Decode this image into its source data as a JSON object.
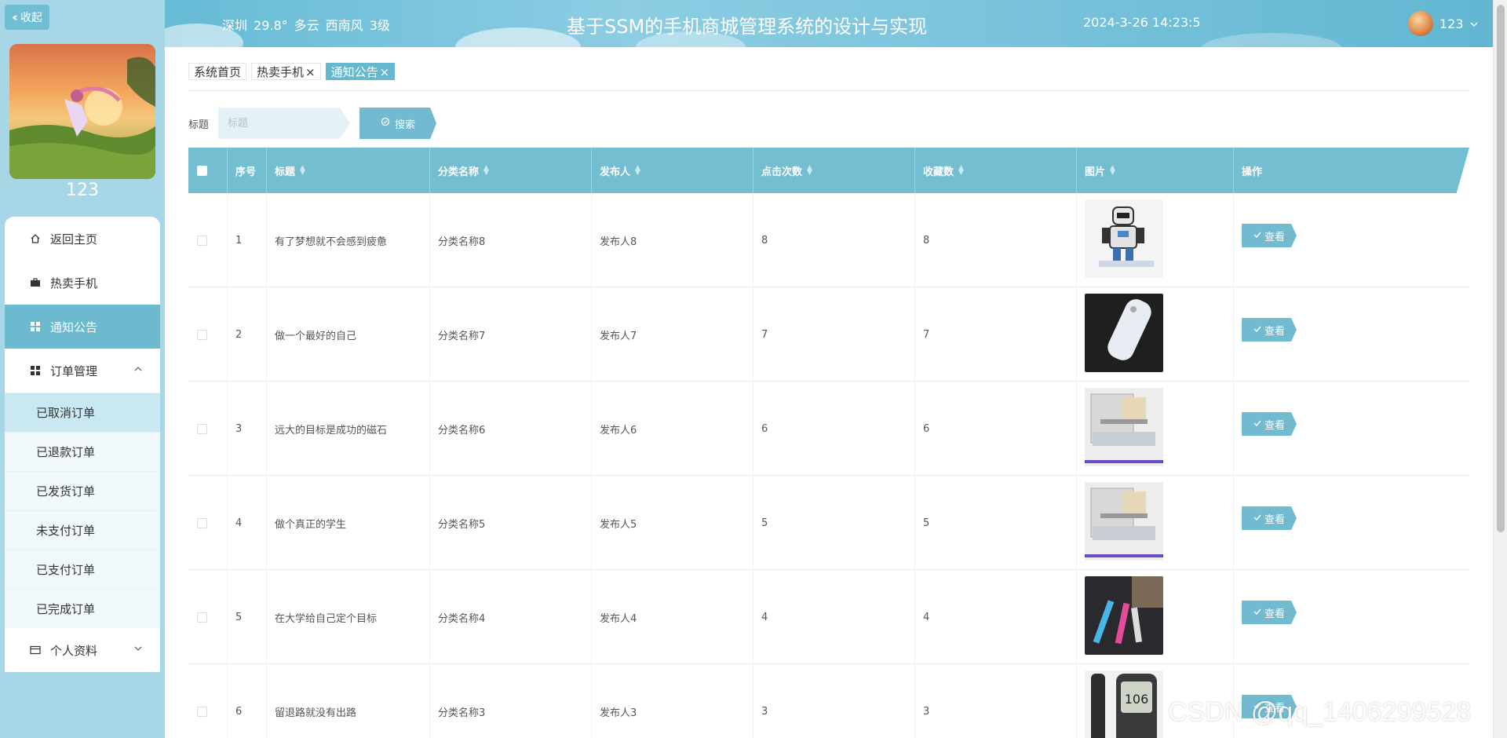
{
  "sidebar": {
    "collapse_label": "收起",
    "user_name": "123",
    "menu": [
      {
        "label": "返回主页",
        "icon": "home-icon"
      },
      {
        "label": "热卖手机",
        "icon": "briefcase-icon"
      },
      {
        "label": "通知公告",
        "icon": "grid-icon"
      },
      {
        "label": "订单管理",
        "icon": "grid-icon"
      }
    ],
    "order_submenu": [
      "已取消订单",
      "已退款订单",
      "已发货订单",
      "未支付订单",
      "已支付订单",
      "已完成订单"
    ],
    "profile_label": "个人资料"
  },
  "header": {
    "weather": {
      "city": "深圳",
      "temp": "29.8°",
      "condition": "多云",
      "wind": "西南风",
      "level": "3级"
    },
    "title": "基于SSM的手机商城管理系统的设计与实现",
    "datetime": "2024-3-26 14:23:5",
    "user": "123"
  },
  "tabs": [
    {
      "label": "系统首页",
      "closable": false,
      "active": false
    },
    {
      "label": "热卖手机",
      "closable": true,
      "active": false
    },
    {
      "label": "通知公告",
      "closable": true,
      "active": true
    }
  ],
  "search": {
    "label": "标题",
    "placeholder": "标题",
    "button": "搜索"
  },
  "table": {
    "headers": [
      "序号",
      "标题",
      "分类名称",
      "发布人",
      "点击次数",
      "收藏数",
      "图片",
      "操作"
    ],
    "rows": [
      {
        "no": "1",
        "title": "有了梦想就不会感到疲惫",
        "category": "分类名称8",
        "publisher": "发布人8",
        "clicks": "8",
        "favorites": "8",
        "image": "robot-toy"
      },
      {
        "no": "2",
        "title": "做一个最好的自己",
        "category": "分类名称7",
        "publisher": "发布人7",
        "clicks": "7",
        "favorites": "7",
        "image": "white-remote"
      },
      {
        "no": "3",
        "title": "远大的目标是成功的磁石",
        "category": "分类名称6",
        "publisher": "发布人6",
        "clicks": "6",
        "favorites": "6",
        "image": "circuit-kit"
      },
      {
        "no": "4",
        "title": "做个真正的学生",
        "category": "分类名称5",
        "publisher": "发布人5",
        "clicks": "5",
        "favorites": "5",
        "image": "circuit-kit"
      },
      {
        "no": "5",
        "title": "在大学给自己定个目标",
        "category": "分类名称4",
        "publisher": "发布人4",
        "clicks": "4",
        "favorites": "4",
        "image": "pens-dark"
      },
      {
        "no": "6",
        "title": "留退路就没有出路",
        "category": "分类名称3",
        "publisher": "发布人3",
        "clicks": "3",
        "favorites": "3",
        "image": "glucose-meter"
      }
    ],
    "action_label": "查看"
  },
  "watermark": "CSDN @qq_1406299528",
  "colors": {
    "accent": "#72bad0",
    "sidebar_bg": "#a7d7e6",
    "header_th": "#73bed1"
  }
}
